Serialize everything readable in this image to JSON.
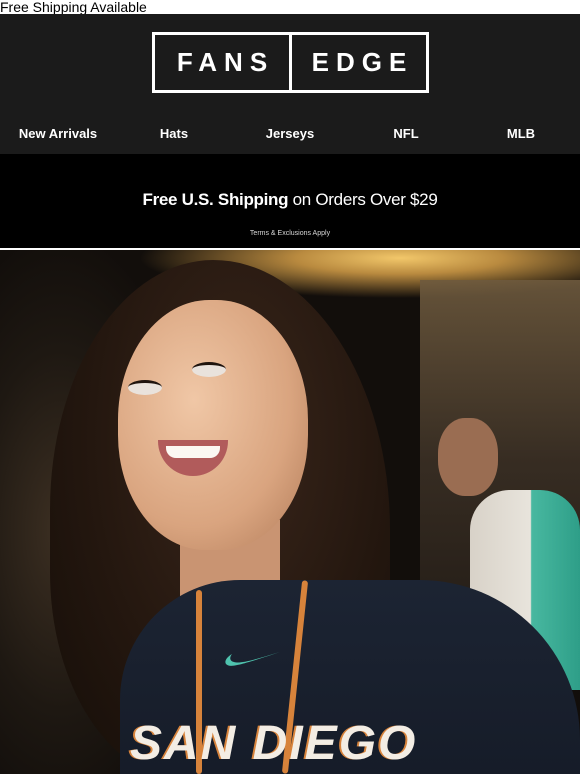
{
  "preheader": {
    "text": "Free Shipping Available"
  },
  "header": {
    "logo": {
      "left": "FANS",
      "right": "EDGE"
    },
    "nav": [
      {
        "label": "New Arrivals"
      },
      {
        "label": "Hats"
      },
      {
        "label": "Jerseys"
      },
      {
        "label": "NFL"
      },
      {
        "label": "MLB"
      }
    ]
  },
  "promo": {
    "bold": "Free U.S. Shipping",
    "rest": "on Orders Over $29",
    "terms": "Terms & Exclusions Apply"
  },
  "hero": {
    "shirt_text": "SAN DIEGO"
  },
  "colors": {
    "header_bg": "#1b1b1b",
    "promo_bg": "#000000",
    "text_on_dark": "#ffffff",
    "accent_orange": "#d7833b",
    "accent_teal": "#4fc3ae"
  }
}
